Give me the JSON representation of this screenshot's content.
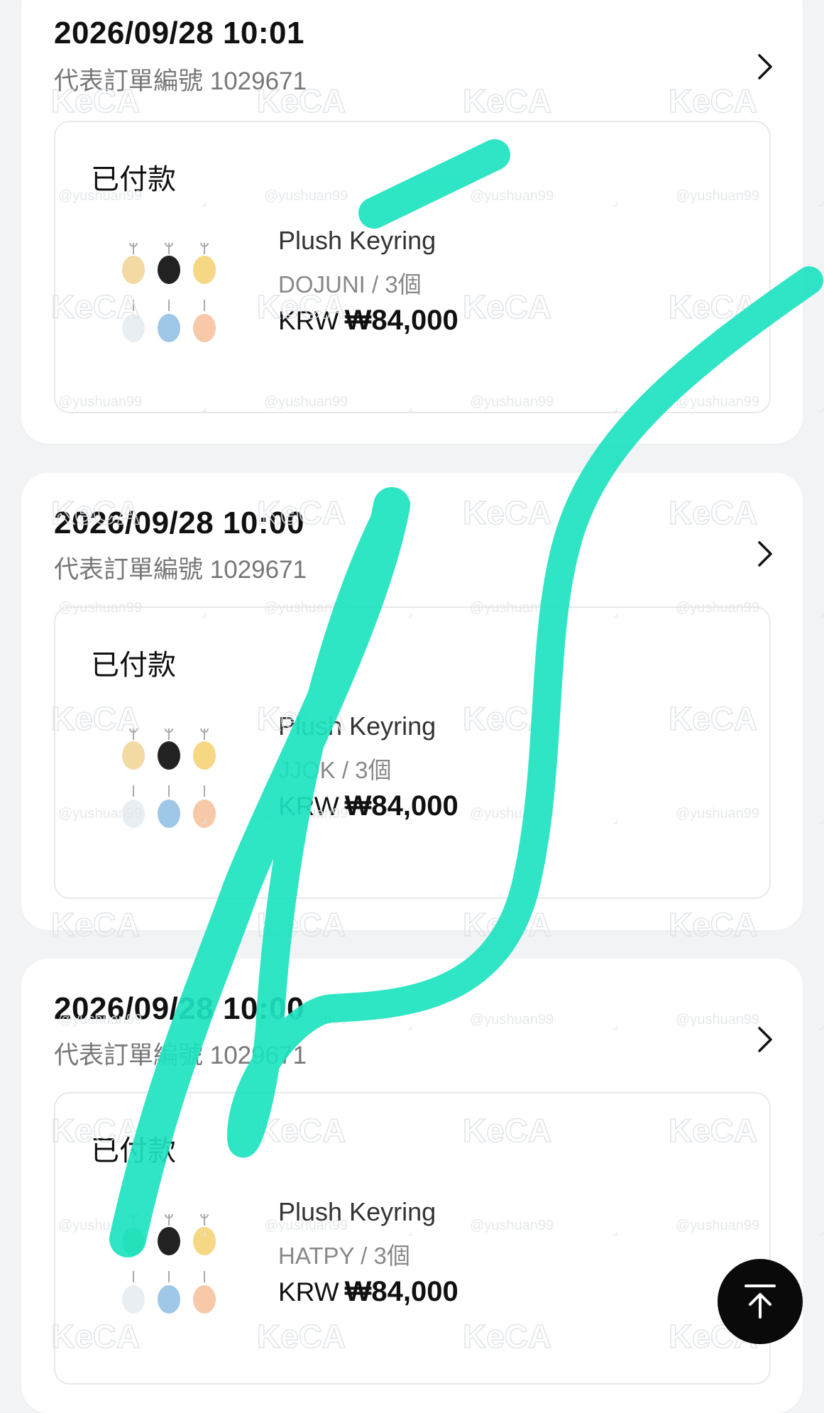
{
  "orders": [
    {
      "date": "2026/09/28 10:01",
      "order_label": "代表訂單編號 1029671",
      "status": "已付款",
      "product_name": "Plush Keyring",
      "option": "DOJUNI / 3個",
      "currency": "KRW",
      "amount": "₩84,000"
    },
    {
      "date": "2026/09/28 10:00",
      "order_label": "代表訂單編號 1029671",
      "status": "已付款",
      "product_name": "Plush Keyring",
      "option": "JJOK / 3個",
      "currency": "KRW",
      "amount": "₩84,000"
    },
    {
      "date": "2026/09/28 10:00",
      "order_label": "代表訂單編號 1029671",
      "status": "已付款",
      "product_name": "Plush Keyring",
      "option": "HATPY / 3個",
      "currency": "KRW",
      "amount": "₩84,000"
    }
  ],
  "watermark": {
    "logo": "KeCA",
    "handle": "@yushuan99"
  },
  "icons": {
    "chevron": "chevron-right-icon",
    "scroll_top": "arrow-up-to-top-icon"
  },
  "colors": {
    "scribble": "#1de3c0",
    "background": "#f1f3f5",
    "top_button": "#0a0a0a"
  }
}
